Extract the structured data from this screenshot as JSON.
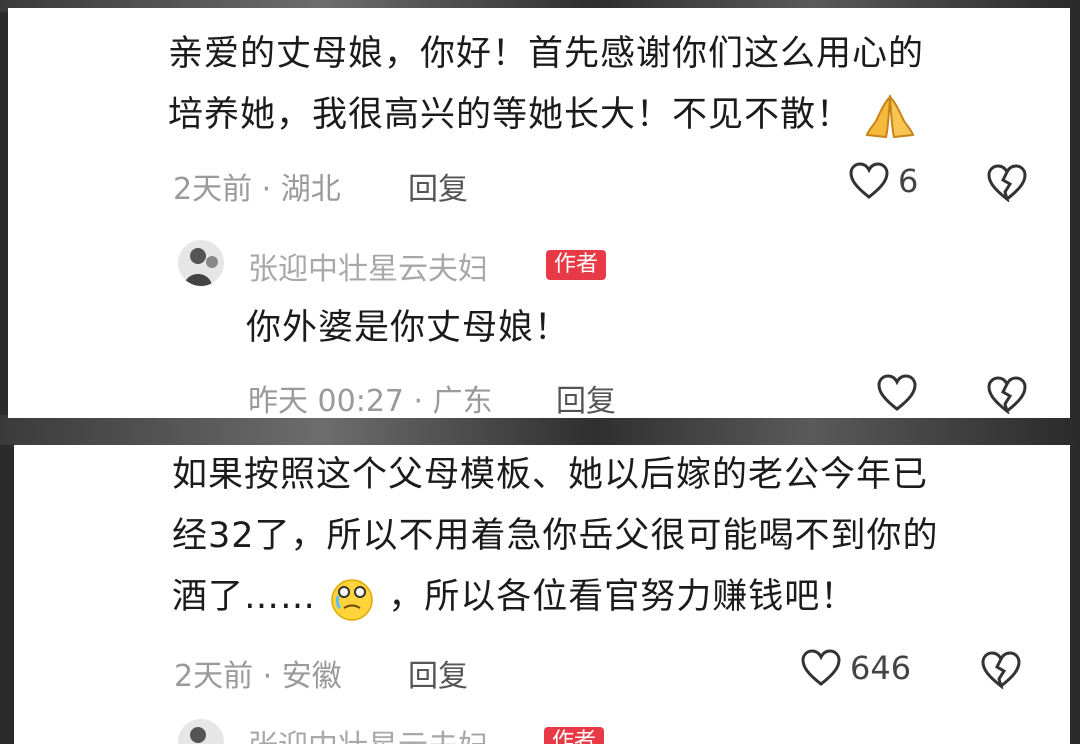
{
  "comments": [
    {
      "line1": "亲爱的丈母娘，你好！首先感谢你们这么用心的",
      "line2": "培养她，我很高兴的等她长大！不见不散！",
      "emoji": "folded-hands",
      "meta": "2天前 · 湖北",
      "reply_label": "回复",
      "like_count": "6",
      "reply": {
        "author": "张迎中壮星云夫妇",
        "badge": "作者",
        "text": "你外婆是你丈母娘！",
        "meta": "昨天 00:27 · 广东",
        "reply_label": "回复",
        "like_count": ""
      }
    },
    {
      "line1": "如果按照这个父母模板、她以后嫁的老公今年已",
      "line2": "经32了，所以不用着急你岳父很可能喝不到你的",
      "line3_pre": "酒了……",
      "line3_post": "，所以各位看官努力赚钱吧！",
      "emoji": "crying-face",
      "meta": "2天前 · 安徽",
      "reply_label": "回复",
      "like_count": "646",
      "reply": {
        "author": "张迎中壮星云夫妇",
        "badge": "作者"
      }
    }
  ]
}
